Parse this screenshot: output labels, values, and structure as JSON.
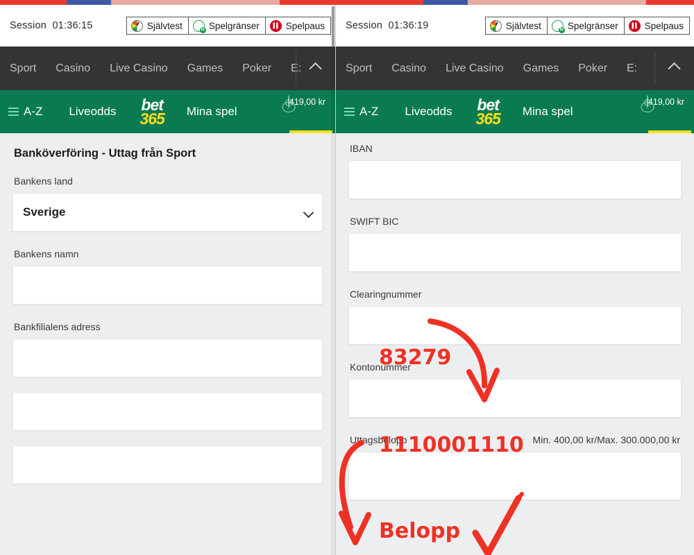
{
  "browser": {
    "top_strip_color": "#e8392c",
    "tab_segment_color": "#3c5aa6"
  },
  "panels": [
    {
      "id": "left",
      "session": {
        "label": "Session",
        "time": "01:36:15"
      },
      "responsible_gaming": [
        {
          "icon": "gauge-icon",
          "label": "Självtest"
        },
        {
          "icon": "coin-kr-icon",
          "label": "Spelgränser"
        },
        {
          "icon": "pause-icon",
          "label": "Spelpaus"
        }
      ],
      "nav": {
        "items": [
          "Sport",
          "Casino",
          "Live Casino",
          "Games",
          "Poker",
          "E:"
        ],
        "collapse_icon": "chevron-up-icon"
      },
      "green_bar": {
        "menu_icon": "hamburger-icon",
        "az": "A-Z",
        "liveodds": "Liveodds",
        "logo_top": "bet",
        "logo_bottom": "365",
        "mina_spel": "Mina spel",
        "account_icon": "user-avatar-icon",
        "balance": "419,00 kr"
      },
      "form": {
        "title": "Banköverföring - Uttag från Sport",
        "fields": [
          {
            "label": "Bankens land",
            "type": "select",
            "value": "Sverige",
            "icon": "chevron-down-icon"
          },
          {
            "label": "Bankens namn",
            "type": "text",
            "value": ""
          },
          {
            "label": "Bankfilialens adress",
            "type": "text",
            "value": ""
          },
          {
            "label": "",
            "type": "text",
            "value": ""
          },
          {
            "label": "",
            "type": "text",
            "value": ""
          }
        ]
      }
    },
    {
      "id": "right",
      "session": {
        "label": "Session",
        "time": "01:36:19"
      },
      "responsible_gaming": [
        {
          "icon": "gauge-icon",
          "label": "Självtest"
        },
        {
          "icon": "coin-kr-icon",
          "label": "Spelgränser"
        },
        {
          "icon": "pause-icon",
          "label": "Spelpaus"
        }
      ],
      "nav": {
        "items": [
          "Sport",
          "Casino",
          "Live Casino",
          "Games",
          "Poker",
          "E:"
        ],
        "collapse_icon": "chevron-up-icon"
      },
      "green_bar": {
        "menu_icon": "hamburger-icon",
        "az": "A-Z",
        "liveodds": "Liveodds",
        "logo_top": "bet",
        "logo_bottom": "365",
        "mina_spel": "Mina spel",
        "account_icon": "user-avatar-icon",
        "balance": "419,00 kr"
      },
      "form": {
        "fields": [
          {
            "label": "IBAN",
            "type": "text",
            "value": ""
          },
          {
            "label": "SWIFT BIC",
            "type": "text",
            "value": ""
          },
          {
            "label": "Clearingnummer",
            "type": "text",
            "value": ""
          },
          {
            "label": "Kontonummer",
            "type": "text",
            "value": ""
          },
          {
            "label": "Uttagsbelopp",
            "hint": "Min. 400,00 kr/Max. 300.000,00 kr",
            "type": "text",
            "value": ""
          }
        ]
      }
    }
  ],
  "annotations": {
    "color": "#ee3124",
    "items": [
      {
        "name": "clearing-number-annotation",
        "text": "83279"
      },
      {
        "name": "account-number-annotation",
        "text": "1110001110"
      },
      {
        "name": "amount-annotation",
        "text": "Belopp"
      }
    ],
    "marks": [
      {
        "name": "arrow-to-clearing-field",
        "shape": "curved-arrow"
      },
      {
        "name": "arrow-to-amount-field",
        "shape": "curved-arrow"
      },
      {
        "name": "checkmark-amount-limits",
        "shape": "check"
      }
    ]
  }
}
